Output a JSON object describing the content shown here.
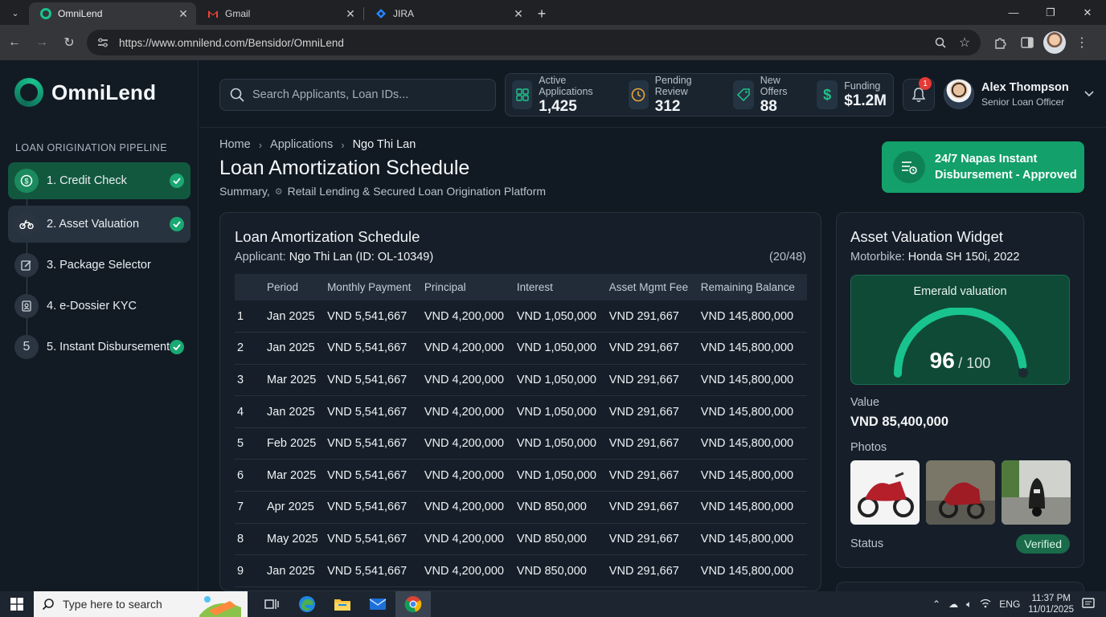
{
  "browser": {
    "tabs": [
      {
        "title": "OmniLend",
        "active": true
      },
      {
        "title": "Gmail",
        "active": false
      },
      {
        "title": "JIRA",
        "active": false
      }
    ],
    "url": "https://www.omnilend.com/Bensidor/OmniLend"
  },
  "sidebar": {
    "brand": "OmniLend",
    "heading": "LOAN ORIGINATION PIPELINE",
    "steps": [
      {
        "label": "1. Credit Check",
        "done": true
      },
      {
        "label": "2. Asset Valuation",
        "done": true
      },
      {
        "label": "3. Package Selector",
        "done": false
      },
      {
        "label": "4. e-Dossier KYC",
        "done": false
      },
      {
        "label": "5. Instant Disbursement",
        "done": true,
        "number": "5"
      }
    ]
  },
  "header": {
    "search_placeholder": "Search Applicants, Loan IDs...",
    "stats": [
      {
        "label": "Active Applications",
        "value": "1,425",
        "icon": "grid-icon"
      },
      {
        "label": "Pending Review",
        "value": "312",
        "icon": "clock-icon"
      },
      {
        "label": "New Offers",
        "value": "88",
        "icon": "tag-icon"
      },
      {
        "label": "Funding",
        "value": "$1.2M",
        "icon": "dollar-icon"
      }
    ],
    "notifications": "1",
    "user": {
      "name": "Alex Thompson",
      "role": "Senior Loan Officer"
    }
  },
  "page": {
    "breadcrumb": [
      "Home",
      "Applications",
      "Ngo Thi Lan"
    ],
    "title": "Loan Amortization Schedule",
    "subtitle_prefix": "Summary,",
    "subtitle": "Retail Lending & Secured Loan Origination Platform",
    "approval_banner": {
      "line1": "24/7 Napas Instant",
      "line2": "Disbursement - Approved"
    }
  },
  "schedule": {
    "title": "Loan Amortization Schedule",
    "applicant_label": "Applicant:",
    "applicant": "Ngo Thi Lan (ID: OL-10349)",
    "counter": "(20/48)",
    "columns": [
      "",
      "Period",
      "Monthly Payment",
      "Principal",
      "Interest",
      "Asset Mgmt Fee",
      "Remaining Balance"
    ],
    "rows": [
      [
        "1",
        "Jan 2025",
        "VND 5,541,667",
        "VND 4,200,000",
        "VND 1,050,000",
        "VND 291,667",
        "VND 145,800,000"
      ],
      [
        "2",
        "Jan 2025",
        "VND 5,541,667",
        "VND 4,200,000",
        "VND 1,050,000",
        "VND 291,667",
        "VND 145,800,000"
      ],
      [
        "3",
        "Mar 2025",
        "VND 5,541,667",
        "VND 4,200,000",
        "VND 1,050,000",
        "VND 291,667",
        "VND 145,800,000"
      ],
      [
        "4",
        "Jan 2025",
        "VND 5,541,667",
        "VND 4,200,000",
        "VND 1,050,000",
        "VND 291,667",
        "VND 145,800,000"
      ],
      [
        "5",
        "Feb 2025",
        "VND 5,541,667",
        "VND 4,200,000",
        "VND 1,050,000",
        "VND 291,667",
        "VND 145,800,000"
      ],
      [
        "6",
        "Mar 2025",
        "VND 5,541,667",
        "VND 4,200,000",
        "VND 1,050,000",
        "VND 291,667",
        "VND 145,800,000"
      ],
      [
        "7",
        "Apr 2025",
        "VND 5,541,667",
        "VND 4,200,000",
        "VND 850,000",
        "VND 291,667",
        "VND 145,800,000"
      ],
      [
        "8",
        "May 2025",
        "VND 5,541,667",
        "VND 4,200,000",
        "VND 850,000",
        "VND 291,667",
        "VND 145,800,000"
      ],
      [
        "9",
        "Jan 2025",
        "VND 5,541,667",
        "VND 4,200,000",
        "VND 850,000",
        "VND 291,667",
        "VND 145,800,000"
      ]
    ]
  },
  "asset": {
    "title": "Asset Valuation Widget",
    "vehicle_label": "Motorbike:",
    "vehicle": "Honda SH 150i, 2022",
    "gauge_label": "Emerald valuation",
    "score": "96",
    "score_max": "/ 100",
    "score_fraction": 0.96,
    "value_label": "Value",
    "value": "VND 85,400,000",
    "photos_label": "Photos",
    "status_label": "Status",
    "status": "Verified"
  },
  "taskbar": {
    "search_placeholder": "Type here to search",
    "lang": "ENG",
    "time": "11:37 PM",
    "date": "11/01/2025"
  },
  "colors": {
    "accent": "#13a06a",
    "background": "#111922",
    "card": "#161f29"
  }
}
